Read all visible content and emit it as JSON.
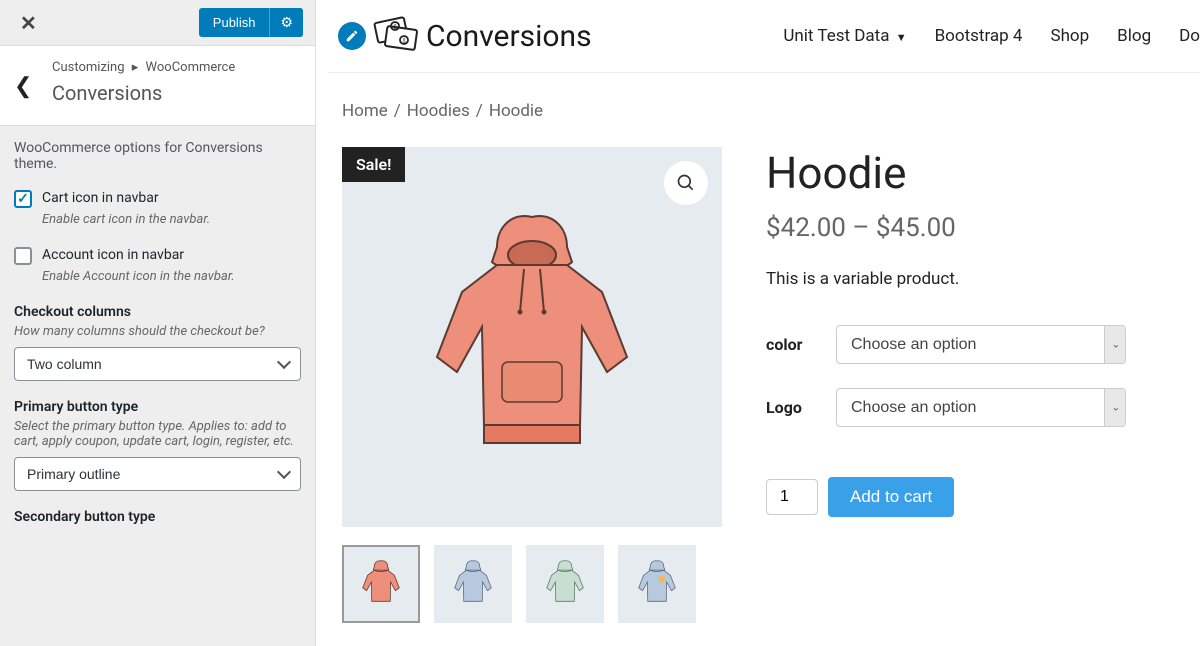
{
  "customizer": {
    "publish": "Publish",
    "breadcrumb1": "Customizing",
    "breadcrumb2": "WooCommerce",
    "section": "Conversions",
    "description": "WooCommerce options for Conversions theme.",
    "cart_icon_label": "Cart icon in navbar",
    "cart_icon_help": "Enable cart icon in the navbar.",
    "account_icon_label": "Account icon in navbar",
    "account_icon_help": "Enable Account icon in the navbar.",
    "checkout_cols_label": "Checkout columns",
    "checkout_cols_help": "How many columns should the checkout be?",
    "checkout_cols_value": "Two column",
    "primary_btn_label": "Primary button type",
    "primary_btn_help": "Select the primary button type. Applies to: add to cart, apply coupon, update cart, login, register, etc.",
    "primary_btn_value": "Primary outline",
    "secondary_btn_label": "Secondary button type"
  },
  "nav": {
    "logo_text": "Conversions",
    "items": [
      "Unit Test Data",
      "Bootstrap 4",
      "Shop",
      "Blog",
      "Do"
    ]
  },
  "breadcrumb": {
    "home": "Home",
    "cat": "Hoodies",
    "prod": "Hoodie"
  },
  "product": {
    "sale": "Sale!",
    "title": "Hoodie",
    "price": "$42.00 – $45.00",
    "description": "This is a variable product.",
    "var_color_label": "color",
    "var_logo_label": "Logo",
    "option_placeholder": "Choose an option",
    "qty": "1",
    "add_to_cart": "Add to cart"
  }
}
